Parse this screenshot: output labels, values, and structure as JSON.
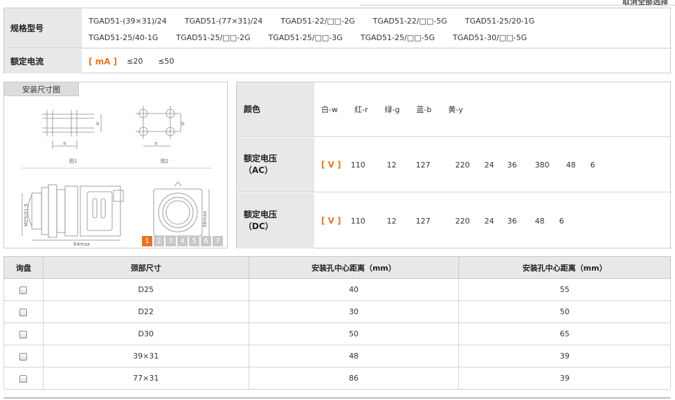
{
  "top_link": "取消全部选择",
  "spec": {
    "model_label": "规格型号",
    "models_row1": [
      "TGAD51-(39×31)/24",
      "TGAD51-(77×31)/24",
      "TGAD51-22/□□-2G",
      "TGAD51-22/□□-5G",
      "TGAD51-25/20-1G"
    ],
    "models_row2": [
      "TGAD51-25/40-1G",
      "TGAD51-25/□□-2G",
      "TGAD51-25/□□-3G",
      "TGAD51-25/□□-5G",
      "TGAD51-30/□□-5G"
    ],
    "current_label": "额定电流",
    "current_unit": "[ mA ]",
    "current_values": [
      "≤20",
      "≤50"
    ]
  },
  "install": {
    "tab_label": "安装尺寸图",
    "fig1_caption": "图1",
    "fig2_caption": "图2",
    "dim_a": "a",
    "dim_b": "b",
    "dim_m": "M25/31.5",
    "dim_64": "64max",
    "dim_36": "36max",
    "pages": [
      "1",
      "2",
      "3",
      "4",
      "5",
      "6",
      "7"
    ],
    "active_page": "1"
  },
  "elec": {
    "color_label": "颜色",
    "colors": [
      "白-w",
      "红-r",
      "绿-g",
      "蓝-b",
      "黄-y"
    ],
    "ac_label_1": "额定电压",
    "ac_label_2": "（AC）",
    "ac_unit": "[ V ]",
    "ac_values": [
      "110",
      "12",
      "127",
      "220",
      "24",
      "36",
      "380",
      "48",
      "6"
    ],
    "dc_label_1": "额定电压",
    "dc_label_2": "（DC）",
    "dc_unit": "[ V ]",
    "dc_values": [
      "110",
      "12",
      "127",
      "220",
      "24",
      "36",
      "48",
      "6"
    ]
  },
  "table": {
    "headers": [
      "询盘",
      "颈部尺寸",
      "安装孔中心距离（mm）",
      "安装孔中心距离（mm）"
    ],
    "rows": [
      {
        "neck": "D25",
        "a": "40",
        "b": "55"
      },
      {
        "neck": "D22",
        "a": "30",
        "b": "50"
      },
      {
        "neck": "D30",
        "a": "50",
        "b": "65"
      },
      {
        "neck": "39×31",
        "a": "48",
        "b": "39"
      },
      {
        "neck": "77×31",
        "a": "86",
        "b": "39"
      }
    ]
  },
  "colors": {
    "accent": "#e8741e",
    "label_bg": "#e8e8e8",
    "border": "#c9c9c9"
  }
}
